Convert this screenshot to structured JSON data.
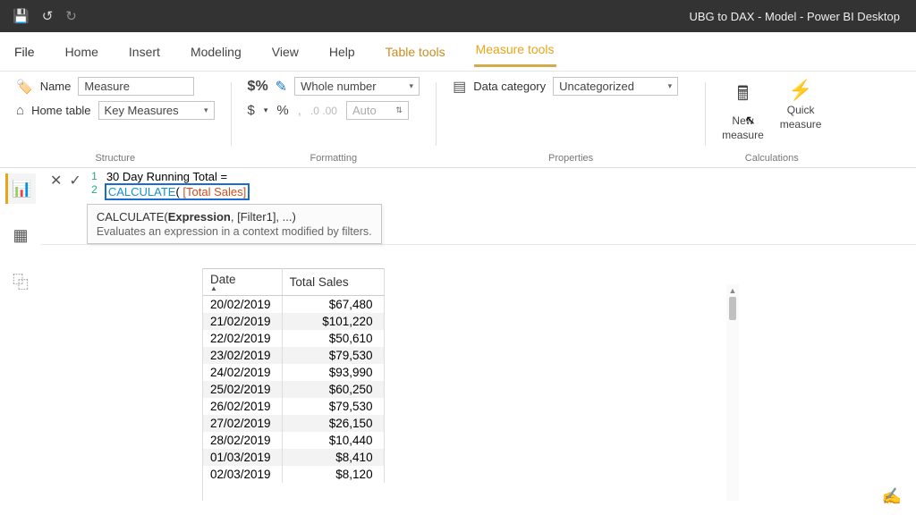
{
  "titlebar": {
    "title": "UBG to DAX - Model - Power BI Desktop"
  },
  "tabs": {
    "file": "File",
    "home": "Home",
    "insert": "Insert",
    "modeling": "Modeling",
    "view": "View",
    "help": "Help",
    "tabletools": "Table tools",
    "measuretools": "Measure tools"
  },
  "ribbon": {
    "structure": {
      "name_label": "Name",
      "name_value": "Measure",
      "hometable_label": "Home table",
      "hometable_value": "Key Measures",
      "group_label": "Structure"
    },
    "formatting": {
      "format_value": "Whole number",
      "auto_placeholder": "Auto",
      "group_label": "Formatting"
    },
    "properties": {
      "datacat_label": "Data category",
      "datacat_value": "Uncategorized",
      "group_label": "Properties"
    },
    "calculations": {
      "new_measure_l1": "New",
      "new_measure_l2": "measure",
      "quick_measure_l1": "Quick",
      "quick_measure_l2": "measure",
      "group_label": "Calculations"
    }
  },
  "formula": {
    "line1": "30 Day Running Total =",
    "line2_func": "CALCULATE",
    "line2_open": "( ",
    "line2_ref": "[Total Sales]",
    "tooltip_sig_pre": "CALCULATE(",
    "tooltip_sig_bold": "Expression",
    "tooltip_sig_post": ", [Filter1], ...)",
    "tooltip_desc": "Evaluates an expression in a context modified by filters."
  },
  "table": {
    "headers": {
      "date": "Date",
      "total": "Total Sales"
    },
    "rows": [
      {
        "date": "20/02/2019",
        "total": "$67,480"
      },
      {
        "date": "21/02/2019",
        "total": "$101,220"
      },
      {
        "date": "22/02/2019",
        "total": "$50,610"
      },
      {
        "date": "23/02/2019",
        "total": "$79,530"
      },
      {
        "date": "24/02/2019",
        "total": "$93,990"
      },
      {
        "date": "25/02/2019",
        "total": "$60,250"
      },
      {
        "date": "26/02/2019",
        "total": "$79,530"
      },
      {
        "date": "27/02/2019",
        "total": "$26,150"
      },
      {
        "date": "28/02/2019",
        "total": "$10,440"
      },
      {
        "date": "01/03/2019",
        "total": "$8,410"
      },
      {
        "date": "02/03/2019",
        "total": "$8,120"
      }
    ]
  }
}
